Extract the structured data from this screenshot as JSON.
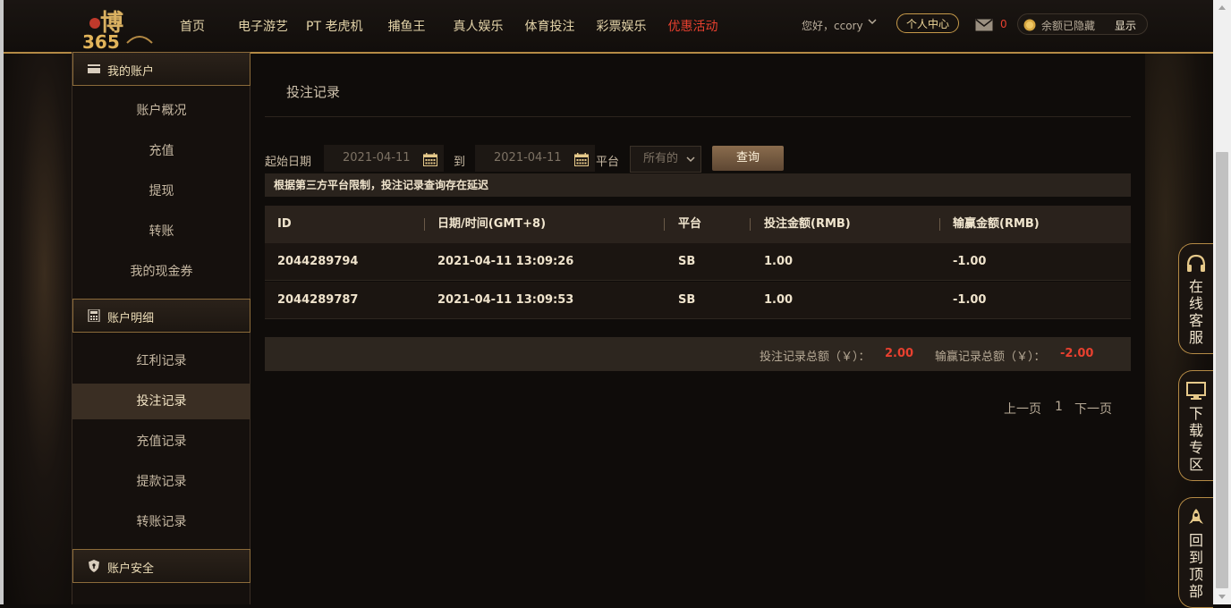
{
  "header": {
    "nav": [
      "首页",
      "电子游艺",
      "PT 老虎机",
      "捕鱼王",
      "真人娱乐",
      "体育投注",
      "彩票娱乐",
      "优惠活动"
    ],
    "greeting": "您好，ccory",
    "personal_center": "个人中心",
    "mail_count": "0",
    "balance_hidden": "余额已隐藏",
    "show_label": "显示"
  },
  "sidebar": {
    "section1": {
      "title": "我的账户",
      "items": [
        "账户概况",
        "充值",
        "提现",
        "转账",
        "我的现金券"
      ]
    },
    "section2": {
      "title": "账户明细",
      "items": [
        "红利记录",
        "投注记录",
        "充值记录",
        "提款记录",
        "转账记录"
      ]
    },
    "section3": {
      "title": "账户安全"
    }
  },
  "content": {
    "title": "投注记录",
    "filters": {
      "start_label": "起始日期",
      "start_date": "2021-04-11",
      "to_label": "到",
      "end_date": "2021-04-11",
      "platform_label": "平台",
      "platform_value": "所有的",
      "query_label": "查询"
    },
    "notice": "根据第三方平台限制，投注记录查询存在延迟",
    "columns": [
      "ID",
      "日期/时间(GMT+8)",
      "平台",
      "投注金额(RMB)",
      "输赢金额(RMB)"
    ],
    "rows": [
      [
        "2044289794",
        "2021-04-11 13:09:26",
        "SB",
        "1.00",
        "-1.00"
      ],
      [
        "2044289787",
        "2021-04-11 13:09:53",
        "SB",
        "1.00",
        "-1.00"
      ]
    ],
    "totals": {
      "bet_label": "投注记录总额（￥）：",
      "bet_value": "2.00",
      "win_label": "输赢记录总额（￥）：",
      "win_value": "-2.00"
    },
    "pager": {
      "prev": "上一页",
      "page": "1",
      "next": "下一页"
    }
  },
  "float": {
    "service": "在线客服",
    "download": "下载专区",
    "top": "回到顶部"
  },
  "colors": {
    "accent": "#b48a45",
    "red": "#e8402f",
    "active_bg": "#3a2e23"
  }
}
